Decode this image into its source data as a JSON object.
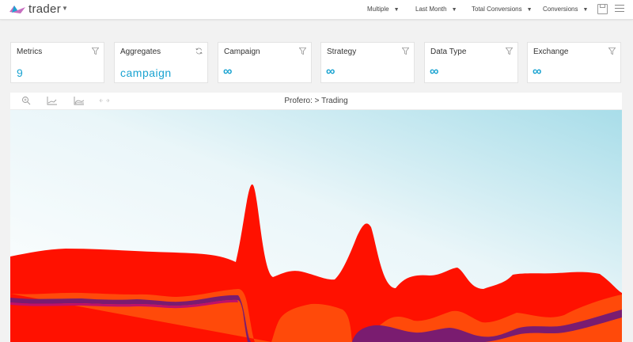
{
  "header": {
    "app_name": "trader",
    "dropdowns": [
      {
        "label": "Multiple"
      },
      {
        "label": "Last Month"
      },
      {
        "label": "Total Conversions"
      },
      {
        "label": "Conversions"
      }
    ]
  },
  "cards": [
    {
      "label": "Metrics",
      "value": "9",
      "icon": "filter-icon"
    },
    {
      "label": "Aggregates",
      "value": "campaign",
      "icon": "refresh-icon"
    },
    {
      "label": "Campaign",
      "value": "∞",
      "icon": "filter-icon"
    },
    {
      "label": "Strategy",
      "value": "∞",
      "icon": "filter-icon"
    },
    {
      "label": "Data Type",
      "value": "∞",
      "icon": "filter-icon"
    },
    {
      "label": "Exchange",
      "value": "∞",
      "icon": "filter-icon"
    }
  ],
  "panel": {
    "breadcrumb": "Profero: > Trading"
  },
  "colors": {
    "accent": "#1aa3d1",
    "stream_top": "#ff1100",
    "stream_mid": "#ff4a0a",
    "stream_purple": "#7a1c70",
    "stream_dark": "#c0106a"
  }
}
